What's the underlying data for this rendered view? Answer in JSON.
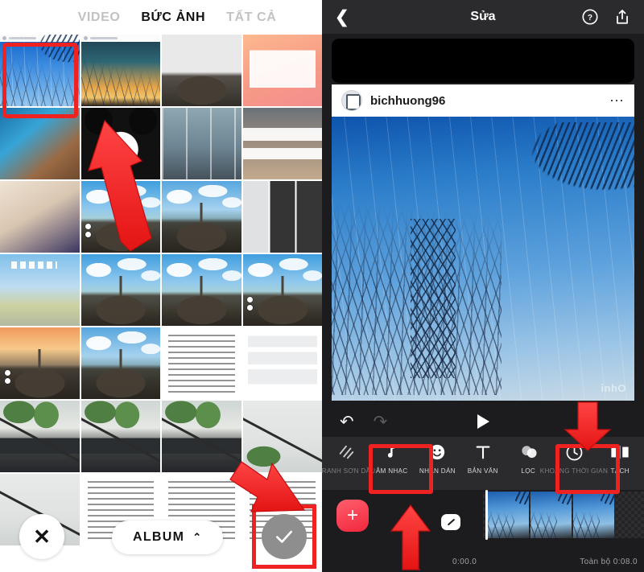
{
  "picker": {
    "tabs": [
      {
        "label": "VIDEO",
        "active": false
      },
      {
        "label": "BỨC ẢNH",
        "active": true
      },
      {
        "label": "TẤT CẢ",
        "active": false
      }
    ],
    "close_label": "✕",
    "album_label": "ALBUM",
    "album_chevron": "⌃",
    "confirm_icon": "checkmark-icon",
    "selected_cell_index": 0,
    "grid": {
      "columns": 4,
      "cells": [
        {
          "id": "c1",
          "kind": "sky-tree-powerline",
          "has_header": true,
          "selected": true
        },
        {
          "id": "c2",
          "kind": "sunset-palm",
          "has_header": true,
          "selected": false
        },
        {
          "id": "c3",
          "kind": "sunset-church",
          "has_header": false,
          "selected": false
        },
        {
          "id": "c4",
          "kind": "promo-card",
          "has_header": false,
          "selected": false
        },
        {
          "id": "c5",
          "kind": "blue-cat",
          "has_header": false,
          "selected": false
        },
        {
          "id": "c6",
          "kind": "panda-meme",
          "has_header": false,
          "selected": false
        },
        {
          "id": "c7",
          "kind": "anime-strip",
          "has_header": false,
          "selected": false
        },
        {
          "id": "c8",
          "kind": "news-article",
          "has_header": false,
          "selected": false
        },
        {
          "id": "c9",
          "kind": "girl-drawing",
          "has_header": false,
          "selected": false
        },
        {
          "id": "c10",
          "kind": "mont-saint-michel",
          "has_header": false,
          "selected": false
        },
        {
          "id": "c11",
          "kind": "mont-saint-michel",
          "has_header": false,
          "selected": false
        },
        {
          "id": "c12",
          "kind": "thumbnail-sheet",
          "has_header": false,
          "selected": false
        },
        {
          "id": "c13",
          "kind": "picnic-poster",
          "has_header": false,
          "selected": false
        },
        {
          "id": "c14",
          "kind": "mont-saint-michel",
          "has_header": false,
          "selected": false
        },
        {
          "id": "c15",
          "kind": "mont-saint-michel",
          "has_header": false,
          "selected": false
        },
        {
          "id": "c16",
          "kind": "mont-saint-michel",
          "has_header": false,
          "selected": false
        },
        {
          "id": "c17",
          "kind": "mont-sunset",
          "has_header": false,
          "selected": false
        },
        {
          "id": "c18",
          "kind": "mont-saint-michel",
          "has_header": false,
          "selected": false
        },
        {
          "id": "c19",
          "kind": "text-screenshot",
          "has_header": false,
          "selected": false
        },
        {
          "id": "c20",
          "kind": "chat-screenshot",
          "has_header": false,
          "selected": false
        },
        {
          "id": "c21",
          "kind": "flower-branch",
          "has_header": false,
          "selected": false
        },
        {
          "id": "c22",
          "kind": "flower-branch",
          "has_header": false,
          "selected": false
        },
        {
          "id": "c23",
          "kind": "flower-branch",
          "has_header": false,
          "selected": false
        },
        {
          "id": "c24",
          "kind": "wall-branch",
          "has_header": false,
          "selected": false
        },
        {
          "id": "c25",
          "kind": "wall-branch",
          "has_header": false,
          "selected": false
        },
        {
          "id": "c26",
          "kind": "text-screenshot",
          "has_header": false,
          "selected": false
        },
        {
          "id": "c27",
          "kind": "text-screenshot",
          "has_header": false,
          "selected": false
        },
        {
          "id": "c28",
          "kind": "text-screenshot",
          "has_header": false,
          "selected": false
        }
      ]
    }
  },
  "editor": {
    "header": {
      "back_icon": "chevron-left-icon",
      "title": "Sửa",
      "help_icon": "question-circle-icon",
      "share_icon": "share-upload-icon"
    },
    "preview": {
      "post_username": "bichhuong96",
      "post_more_icon": "ellipsis-icon",
      "watermark": "inhO"
    },
    "playback": {
      "undo_icon": "undo-arrow-icon",
      "redo_icon": "redo-arrow-icon",
      "play_icon": "play-triangle-icon",
      "undo_enabled": true,
      "redo_enabled": false
    },
    "tools": [
      {
        "label": "TRANH SƠN DẦU",
        "icon": "oil-paint-icon",
        "highlighted": false,
        "dim": true
      },
      {
        "label": "ÂM NHẠC",
        "icon": "music-note-icon",
        "highlighted": true,
        "dim": false
      },
      {
        "label": "NHÃN DÁN",
        "icon": "sticker-smiley-icon",
        "highlighted": false,
        "dim": false
      },
      {
        "label": "BẢN VĂN",
        "icon": "text-t-icon",
        "highlighted": false,
        "dim": false
      },
      {
        "label": "LỌC",
        "icon": "filter-circles-icon",
        "highlighted": false,
        "dim": false
      },
      {
        "label": "KHOẢNG THỜI GIAN",
        "icon": "clock-icon",
        "highlighted": true,
        "dim": true
      },
      {
        "label": "TÁCH",
        "icon": "split-icon",
        "highlighted": false,
        "dim": false
      }
    ],
    "timeline": {
      "add_clip_label": "+",
      "clip_count": 3,
      "transition_icon": "transition-slash-icon",
      "current_time": "0:00.0",
      "total_time": "Toàn bộ 0:08.0"
    }
  },
  "annotations": {
    "highlight_color": "#ef2222",
    "arrows": [
      {
        "name": "arrow-to-selected-photo",
        "points_to": "first photo in grid"
      },
      {
        "name": "arrow-to-confirm-button",
        "points_to": "grey checkmark button"
      },
      {
        "name": "arrow-to-duration-tool",
        "points_to": "KHOẢNG THỜI GIAN tool"
      },
      {
        "name": "arrow-to-music-tool",
        "points_to": "ÂM NHẠC tool"
      }
    ],
    "boxes": [
      {
        "name": "box-selected-photo"
      },
      {
        "name": "box-confirm-button"
      },
      {
        "name": "box-music-tool"
      },
      {
        "name": "box-duration-tool"
      }
    ]
  }
}
